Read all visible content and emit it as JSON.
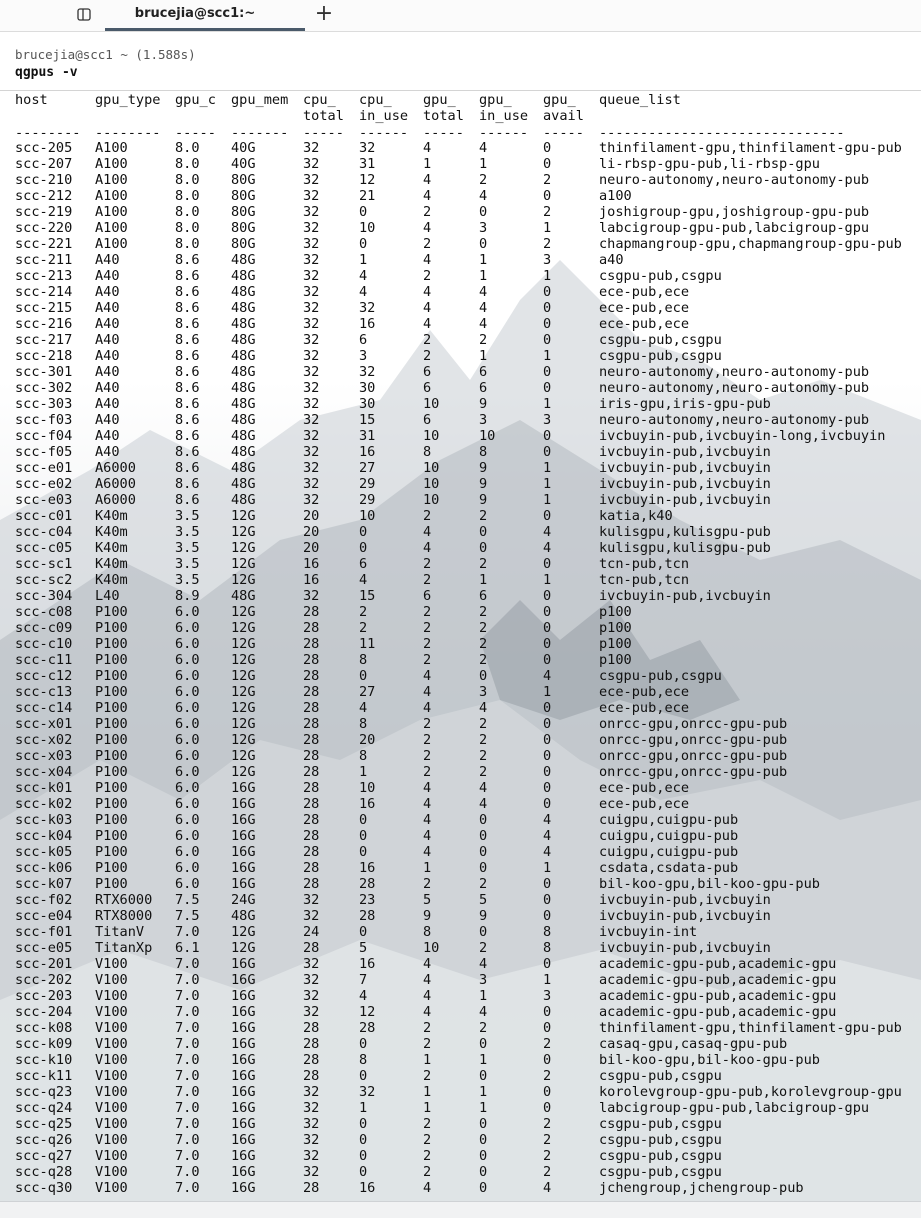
{
  "tab": {
    "label": "brucejia@scc1:~"
  },
  "block": {
    "prompt": "brucejia@scc1 ~ (1.588s)",
    "command": "qgpus -v"
  },
  "table": {
    "columns": [
      {
        "key": "host",
        "l1": "host",
        "l2": "",
        "dash": "--------"
      },
      {
        "key": "gpu_type",
        "l1": "gpu_type",
        "l2": "",
        "dash": "--------"
      },
      {
        "key": "gpu_c",
        "l1": "gpu_c",
        "l2": "",
        "dash": "-----"
      },
      {
        "key": "gpu_mem",
        "l1": "gpu_mem",
        "l2": "",
        "dash": "-------"
      },
      {
        "key": "cpu_total",
        "l1": "cpu_",
        "l2": "total",
        "dash": "-----"
      },
      {
        "key": "cpu_in_use",
        "l1": "cpu_",
        "l2": "in_use",
        "dash": "------"
      },
      {
        "key": "gpu_total",
        "l1": "gpu_",
        "l2": "total",
        "dash": "-----"
      },
      {
        "key": "gpu_in_use",
        "l1": "gpu_",
        "l2": "in_use",
        "dash": "------"
      },
      {
        "key": "gpu_avail",
        "l1": "gpu_",
        "l2": "avail",
        "dash": "-----"
      },
      {
        "key": "queue_list",
        "l1": "queue_list",
        "l2": "",
        "dash": "------------------------------"
      }
    ],
    "rows": [
      [
        "scc-205",
        "A100",
        "8.0",
        "40G",
        "32",
        "32",
        "4",
        "4",
        "0",
        "thinfilament-gpu,thinfilament-gpu-pub"
      ],
      [
        "scc-207",
        "A100",
        "8.0",
        "40G",
        "32",
        "31",
        "1",
        "1",
        "0",
        "li-rbsp-gpu-pub,li-rbsp-gpu"
      ],
      [
        "scc-210",
        "A100",
        "8.0",
        "80G",
        "32",
        "12",
        "4",
        "2",
        "2",
        "neuro-autonomy,neuro-autonomy-pub"
      ],
      [
        "scc-212",
        "A100",
        "8.0",
        "80G",
        "32",
        "21",
        "4",
        "4",
        "0",
        "a100"
      ],
      [
        "scc-219",
        "A100",
        "8.0",
        "80G",
        "32",
        "0",
        "2",
        "0",
        "2",
        "joshigroup-gpu,joshigroup-gpu-pub"
      ],
      [
        "scc-220",
        "A100",
        "8.0",
        "80G",
        "32",
        "10",
        "4",
        "3",
        "1",
        "labcigroup-gpu-pub,labcigroup-gpu"
      ],
      [
        "scc-221",
        "A100",
        "8.0",
        "80G",
        "32",
        "0",
        "2",
        "0",
        "2",
        "chapmangroup-gpu,chapmangroup-gpu-pub"
      ],
      [
        "scc-211",
        "A40",
        "8.6",
        "48G",
        "32",
        "1",
        "4",
        "1",
        "3",
        "a40"
      ],
      [
        "scc-213",
        "A40",
        "8.6",
        "48G",
        "32",
        "4",
        "2",
        "1",
        "1",
        "csgpu-pub,csgpu"
      ],
      [
        "scc-214",
        "A40",
        "8.6",
        "48G",
        "32",
        "4",
        "4",
        "4",
        "0",
        "ece-pub,ece"
      ],
      [
        "scc-215",
        "A40",
        "8.6",
        "48G",
        "32",
        "32",
        "4",
        "4",
        "0",
        "ece-pub,ece"
      ],
      [
        "scc-216",
        "A40",
        "8.6",
        "48G",
        "32",
        "16",
        "4",
        "4",
        "0",
        "ece-pub,ece"
      ],
      [
        "scc-217",
        "A40",
        "8.6",
        "48G",
        "32",
        "6",
        "2",
        "2",
        "0",
        "csgpu-pub,csgpu"
      ],
      [
        "scc-218",
        "A40",
        "8.6",
        "48G",
        "32",
        "3",
        "2",
        "1",
        "1",
        "csgpu-pub,csgpu"
      ],
      [
        "scc-301",
        "A40",
        "8.6",
        "48G",
        "32",
        "32",
        "6",
        "6",
        "0",
        "neuro-autonomy,neuro-autonomy-pub"
      ],
      [
        "scc-302",
        "A40",
        "8.6",
        "48G",
        "32",
        "30",
        "6",
        "6",
        "0",
        "neuro-autonomy,neuro-autonomy-pub"
      ],
      [
        "scc-303",
        "A40",
        "8.6",
        "48G",
        "32",
        "30",
        "10",
        "9",
        "1",
        "iris-gpu,iris-gpu-pub"
      ],
      [
        "scc-f03",
        "A40",
        "8.6",
        "48G",
        "32",
        "15",
        "6",
        "3",
        "3",
        "neuro-autonomy,neuro-autonomy-pub"
      ],
      [
        "scc-f04",
        "A40",
        "8.6",
        "48G",
        "32",
        "31",
        "10",
        "10",
        "0",
        "ivcbuyin-pub,ivcbuyin-long,ivcbuyin"
      ],
      [
        "scc-f05",
        "A40",
        "8.6",
        "48G",
        "32",
        "16",
        "8",
        "8",
        "0",
        "ivcbuyin-pub,ivcbuyin"
      ],
      [
        "scc-e01",
        "A6000",
        "8.6",
        "48G",
        "32",
        "27",
        "10",
        "9",
        "1",
        "ivcbuyin-pub,ivcbuyin"
      ],
      [
        "scc-e02",
        "A6000",
        "8.6",
        "48G",
        "32",
        "29",
        "10",
        "9",
        "1",
        "ivcbuyin-pub,ivcbuyin"
      ],
      [
        "scc-e03",
        "A6000",
        "8.6",
        "48G",
        "32",
        "29",
        "10",
        "9",
        "1",
        "ivcbuyin-pub,ivcbuyin"
      ],
      [
        "scc-c01",
        "K40m",
        "3.5",
        "12G",
        "20",
        "10",
        "2",
        "2",
        "0",
        "katia,k40"
      ],
      [
        "scc-c04",
        "K40m",
        "3.5",
        "12G",
        "20",
        "0",
        "4",
        "0",
        "4",
        "kulisgpu,kulisgpu-pub"
      ],
      [
        "scc-c05",
        "K40m",
        "3.5",
        "12G",
        "20",
        "0",
        "4",
        "0",
        "4",
        "kulisgpu,kulisgpu-pub"
      ],
      [
        "scc-sc1",
        "K40m",
        "3.5",
        "12G",
        "16",
        "6",
        "2",
        "2",
        "0",
        "tcn-pub,tcn"
      ],
      [
        "scc-sc2",
        "K40m",
        "3.5",
        "12G",
        "16",
        "4",
        "2",
        "1",
        "1",
        "tcn-pub,tcn"
      ],
      [
        "scc-304",
        "L40",
        "8.9",
        "48G",
        "32",
        "15",
        "6",
        "6",
        "0",
        "ivcbuyin-pub,ivcbuyin"
      ],
      [
        "scc-c08",
        "P100",
        "6.0",
        "12G",
        "28",
        "2",
        "2",
        "2",
        "0",
        "p100"
      ],
      [
        "scc-c09",
        "P100",
        "6.0",
        "12G",
        "28",
        "2",
        "2",
        "2",
        "0",
        "p100"
      ],
      [
        "scc-c10",
        "P100",
        "6.0",
        "12G",
        "28",
        "11",
        "2",
        "2",
        "0",
        "p100"
      ],
      [
        "scc-c11",
        "P100",
        "6.0",
        "12G",
        "28",
        "8",
        "2",
        "2",
        "0",
        "p100"
      ],
      [
        "scc-c12",
        "P100",
        "6.0",
        "12G",
        "28",
        "0",
        "4",
        "0",
        "4",
        "csgpu-pub,csgpu"
      ],
      [
        "scc-c13",
        "P100",
        "6.0",
        "12G",
        "28",
        "27",
        "4",
        "3",
        "1",
        "ece-pub,ece"
      ],
      [
        "scc-c14",
        "P100",
        "6.0",
        "12G",
        "28",
        "4",
        "4",
        "4",
        "0",
        "ece-pub,ece"
      ],
      [
        "scc-x01",
        "P100",
        "6.0",
        "12G",
        "28",
        "8",
        "2",
        "2",
        "0",
        "onrcc-gpu,onrcc-gpu-pub"
      ],
      [
        "scc-x02",
        "P100",
        "6.0",
        "12G",
        "28",
        "20",
        "2",
        "2",
        "0",
        "onrcc-gpu,onrcc-gpu-pub"
      ],
      [
        "scc-x03",
        "P100",
        "6.0",
        "12G",
        "28",
        "8",
        "2",
        "2",
        "0",
        "onrcc-gpu,onrcc-gpu-pub"
      ],
      [
        "scc-x04",
        "P100",
        "6.0",
        "12G",
        "28",
        "1",
        "2",
        "2",
        "0",
        "onrcc-gpu,onrcc-gpu-pub"
      ],
      [
        "scc-k01",
        "P100",
        "6.0",
        "16G",
        "28",
        "10",
        "4",
        "4",
        "0",
        "ece-pub,ece"
      ],
      [
        "scc-k02",
        "P100",
        "6.0",
        "16G",
        "28",
        "16",
        "4",
        "4",
        "0",
        "ece-pub,ece"
      ],
      [
        "scc-k03",
        "P100",
        "6.0",
        "16G",
        "28",
        "0",
        "4",
        "0",
        "4",
        "cuigpu,cuigpu-pub"
      ],
      [
        "scc-k04",
        "P100",
        "6.0",
        "16G",
        "28",
        "0",
        "4",
        "0",
        "4",
        "cuigpu,cuigpu-pub"
      ],
      [
        "scc-k05",
        "P100",
        "6.0",
        "16G",
        "28",
        "0",
        "4",
        "0",
        "4",
        "cuigpu,cuigpu-pub"
      ],
      [
        "scc-k06",
        "P100",
        "6.0",
        "16G",
        "28",
        "16",
        "1",
        "0",
        "1",
        "csdata,csdata-pub"
      ],
      [
        "scc-k07",
        "P100",
        "6.0",
        "16G",
        "28",
        "28",
        "2",
        "2",
        "0",
        "bil-koo-gpu,bil-koo-gpu-pub"
      ],
      [
        "scc-f02",
        "RTX6000",
        "7.5",
        "24G",
        "32",
        "23",
        "5",
        "5",
        "0",
        "ivcbuyin-pub,ivcbuyin"
      ],
      [
        "scc-e04",
        "RTX8000",
        "7.5",
        "48G",
        "32",
        "28",
        "9",
        "9",
        "0",
        "ivcbuyin-pub,ivcbuyin"
      ],
      [
        "scc-f01",
        "TitanV",
        "7.0",
        "12G",
        "24",
        "0",
        "8",
        "0",
        "8",
        "ivcbuyin-int"
      ],
      [
        "scc-e05",
        "TitanXp",
        "6.1",
        "12G",
        "28",
        "5",
        "10",
        "2",
        "8",
        "ivcbuyin-pub,ivcbuyin"
      ],
      [
        "scc-201",
        "V100",
        "7.0",
        "16G",
        "32",
        "16",
        "4",
        "4",
        "0",
        "academic-gpu-pub,academic-gpu"
      ],
      [
        "scc-202",
        "V100",
        "7.0",
        "16G",
        "32",
        "7",
        "4",
        "3",
        "1",
        "academic-gpu-pub,academic-gpu"
      ],
      [
        "scc-203",
        "V100",
        "7.0",
        "16G",
        "32",
        "4",
        "4",
        "1",
        "3",
        "academic-gpu-pub,academic-gpu"
      ],
      [
        "scc-204",
        "V100",
        "7.0",
        "16G",
        "32",
        "12",
        "4",
        "4",
        "0",
        "academic-gpu-pub,academic-gpu"
      ],
      [
        "scc-k08",
        "V100",
        "7.0",
        "16G",
        "28",
        "28",
        "2",
        "2",
        "0",
        "thinfilament-gpu,thinfilament-gpu-pub"
      ],
      [
        "scc-k09",
        "V100",
        "7.0",
        "16G",
        "28",
        "0",
        "2",
        "0",
        "2",
        "casaq-gpu,casaq-gpu-pub"
      ],
      [
        "scc-k10",
        "V100",
        "7.0",
        "16G",
        "28",
        "8",
        "1",
        "1",
        "0",
        "bil-koo-gpu,bil-koo-gpu-pub"
      ],
      [
        "scc-k11",
        "V100",
        "7.0",
        "16G",
        "28",
        "0",
        "2",
        "0",
        "2",
        "csgpu-pub,csgpu"
      ],
      [
        "scc-q23",
        "V100",
        "7.0",
        "16G",
        "32",
        "32",
        "1",
        "1",
        "0",
        "korolevgroup-gpu-pub,korolevgroup-gpu"
      ],
      [
        "scc-q24",
        "V100",
        "7.0",
        "16G",
        "32",
        "1",
        "1",
        "1",
        "0",
        "labcigroup-gpu-pub,labcigroup-gpu"
      ],
      [
        "scc-q25",
        "V100",
        "7.0",
        "16G",
        "32",
        "0",
        "2",
        "0",
        "2",
        "csgpu-pub,csgpu"
      ],
      [
        "scc-q26",
        "V100",
        "7.0",
        "16G",
        "32",
        "0",
        "2",
        "0",
        "2",
        "csgpu-pub,csgpu"
      ],
      [
        "scc-q27",
        "V100",
        "7.0",
        "16G",
        "32",
        "0",
        "2",
        "0",
        "2",
        "csgpu-pub,csgpu"
      ],
      [
        "scc-q28",
        "V100",
        "7.0",
        "16G",
        "32",
        "0",
        "2",
        "0",
        "2",
        "csgpu-pub,csgpu"
      ],
      [
        "scc-q30",
        "V100",
        "7.0",
        "16G",
        "28",
        "16",
        "4",
        "0",
        "4",
        "jchengroup,jchengroup-pub"
      ]
    ]
  }
}
